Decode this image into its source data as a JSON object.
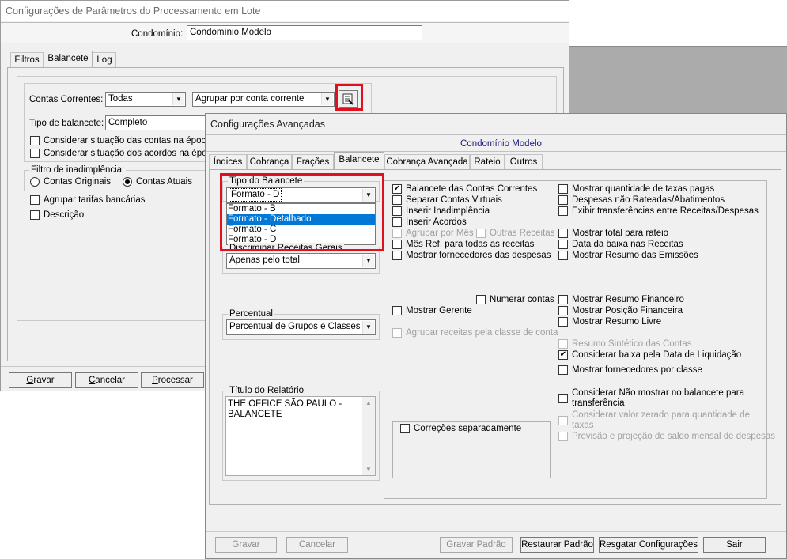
{
  "bg_window": {
    "title": "Configurações de Parâmetros do Processamento em Lote",
    "condominio_label": "Condomínio:",
    "condominio_value": "Condomínio Modelo",
    "tabs": [
      "Filtros",
      "Balancete",
      "Log"
    ],
    "contas_correntes_label": "Contas Correntes:",
    "contas_correntes_value": "Todas",
    "agrupar_value": "Agrupar por conta corrente",
    "tipo_balancete_label": "Tipo de balancete:",
    "tipo_balancete_value": "Completo",
    "check_situacao_contas": "Considerar situação das contas na época",
    "check_situacao_acordos": "Considerar situação dos acordos na época",
    "filtro_legend": "Filtro de inadimplência:",
    "radio_originais": "Contas Originais",
    "radio_atuais": "Contas Atuais",
    "check_tarifas": "Agrupar tarifas bancárias",
    "check_descricao": "Descrição",
    "btn_gravar_u": "G",
    "btn_gravar_rest": "ravar",
    "btn_cancelar_u": "C",
    "btn_cancelar_rest": "ancelar",
    "btn_processar_u": "P",
    "btn_processar_rest": "rocessar"
  },
  "dialog": {
    "title": "Configurações Avançadas",
    "header": "Condomínio Modelo",
    "header_color": "#1a1a7a",
    "tabs": [
      "Índices",
      "Cobrança",
      "Frações",
      "Balancete",
      "Cobrança Avançada",
      "Rateio",
      "Outros"
    ],
    "tipo_legend": "Tipo do Balancete",
    "tipo_selected": "Formato - D",
    "tipo_options": [
      "Formato - B",
      "Formato - Detalhado",
      "Formato - C",
      "Formato - D"
    ],
    "tipo_highlighted": "Formato - Detalhado",
    "discriminar_legend": "Discriminar Receitas Gerais",
    "discriminar_value": "Apenas pelo total",
    "percentual_legend": "Percentual",
    "percentual_value": "Percentual de Grupos e Classes",
    "titulo_legend": "Título do Relatório",
    "titulo_text": "THE OFFICE SÃO PAULO - BALANCETE",
    "checks_col1": {
      "balancete_contas": "Balancete das Contas Correntes",
      "separar_virtuais": "Separar Contas Virtuais",
      "inserir_inadimplencia": "Inserir Inadimplência",
      "inserir_acordos": "Inserir Acordos",
      "agrupar_mes": "Agrupar por Mês",
      "outras_receitas": "Outras Receitas",
      "mes_ref": "Mês Ref. para todas as receitas",
      "mostrar_fornecedores": "Mostrar fornecedores das despesas",
      "numerar_contas": "Numerar contas",
      "mostrar_gerente": "Mostrar Gerente",
      "agrupar_receitas_classe": "Agrupar receitas pela classe de conta",
      "correcoes": "Correções separadamente"
    },
    "checks_col2": {
      "qtd_taxas": "Mostrar quantidade de taxas pagas",
      "despesas_nao_rateadas": "Despesas não Rateadas/Abatimentos",
      "exibir_transferencias": "Exibir transferências entre Receitas/Despesas",
      "total_rateio": "Mostrar total para rateio",
      "data_baixa": "Data da baixa nas Receitas",
      "resumo_emissoes": "Mostrar Resumo das Emissões",
      "resumo_financeiro": "Mostrar Resumo Financeiro",
      "posicao_financeira": "Mostrar Posição Financeira",
      "resumo_livre": "Mostrar Resumo Livre",
      "resumo_sintetico": "Resumo Sintético das Contas",
      "considerar_baixa": "Considerar baixa pela Data de Liquidação",
      "fornecedores_classe": "Mostrar fornecedores por classe",
      "nao_mostrar": "Considerar Não mostrar no balancete para transferência",
      "valor_zerado": "Considerar valor zerado para quantidade de taxas",
      "previsao": "Previsão e projeção de saldo mensal de despesas"
    },
    "check_mark": "✔",
    "buttons": {
      "gravar": "Gravar",
      "cancelar": "Cancelar",
      "gravar_padrao": "Gravar Padrão",
      "restaurar_padrao": "Restaurar Padrão",
      "resgatar": "Resgatar Configurações",
      "sair": "Sair"
    }
  },
  "colors": {
    "highlight": "#0078d7",
    "annotation_red": "#e0101f"
  }
}
